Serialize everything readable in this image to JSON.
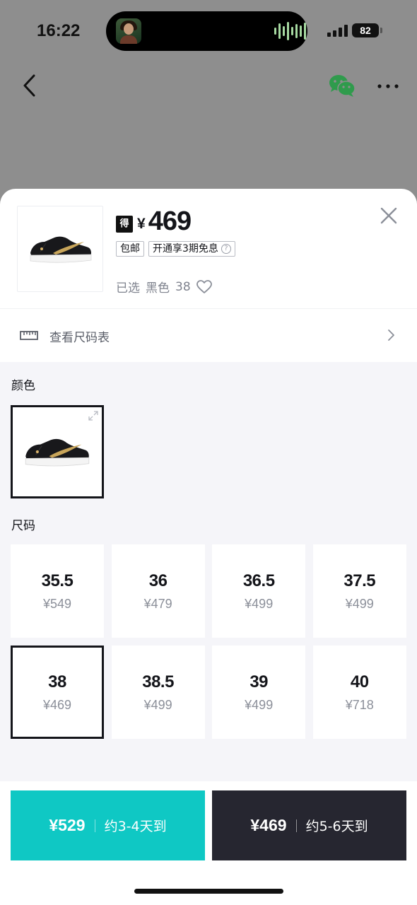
{
  "status_bar": {
    "time": "16:22",
    "battery": "82"
  },
  "nav": {
    "back_icon": "chevron-left-icon",
    "share_icon": "wechat-icon",
    "more_icon": "more-dots-icon"
  },
  "product": {
    "currency": "¥",
    "price": "469",
    "logo_text": "得物",
    "tags": [
      {
        "label": "包邮"
      },
      {
        "label": "开通享3期免息",
        "help": "?"
      }
    ],
    "selected_prefix": "已选",
    "selected_color": "黑色",
    "selected_size": "38"
  },
  "size_chart": {
    "label": "查看尺码表"
  },
  "color_section": {
    "label": "颜色"
  },
  "size_section": {
    "label": "尺码",
    "sizes": [
      {
        "size": "35.5",
        "price": "¥549"
      },
      {
        "size": "36",
        "price": "¥479"
      },
      {
        "size": "36.5",
        "price": "¥499"
      },
      {
        "size": "37.5",
        "price": "¥499"
      },
      {
        "size": "38",
        "price": "¥469",
        "selected": true
      },
      {
        "size": "38.5",
        "price": "¥499"
      },
      {
        "size": "39",
        "price": "¥499"
      },
      {
        "size": "40",
        "price": "¥718"
      }
    ]
  },
  "buttons": {
    "fast": {
      "price": "¥529",
      "eta": "约3-4天到",
      "color": "#0fc8c4"
    },
    "normal": {
      "price": "¥469",
      "eta": "约5-6天到",
      "color": "#262630"
    }
  }
}
